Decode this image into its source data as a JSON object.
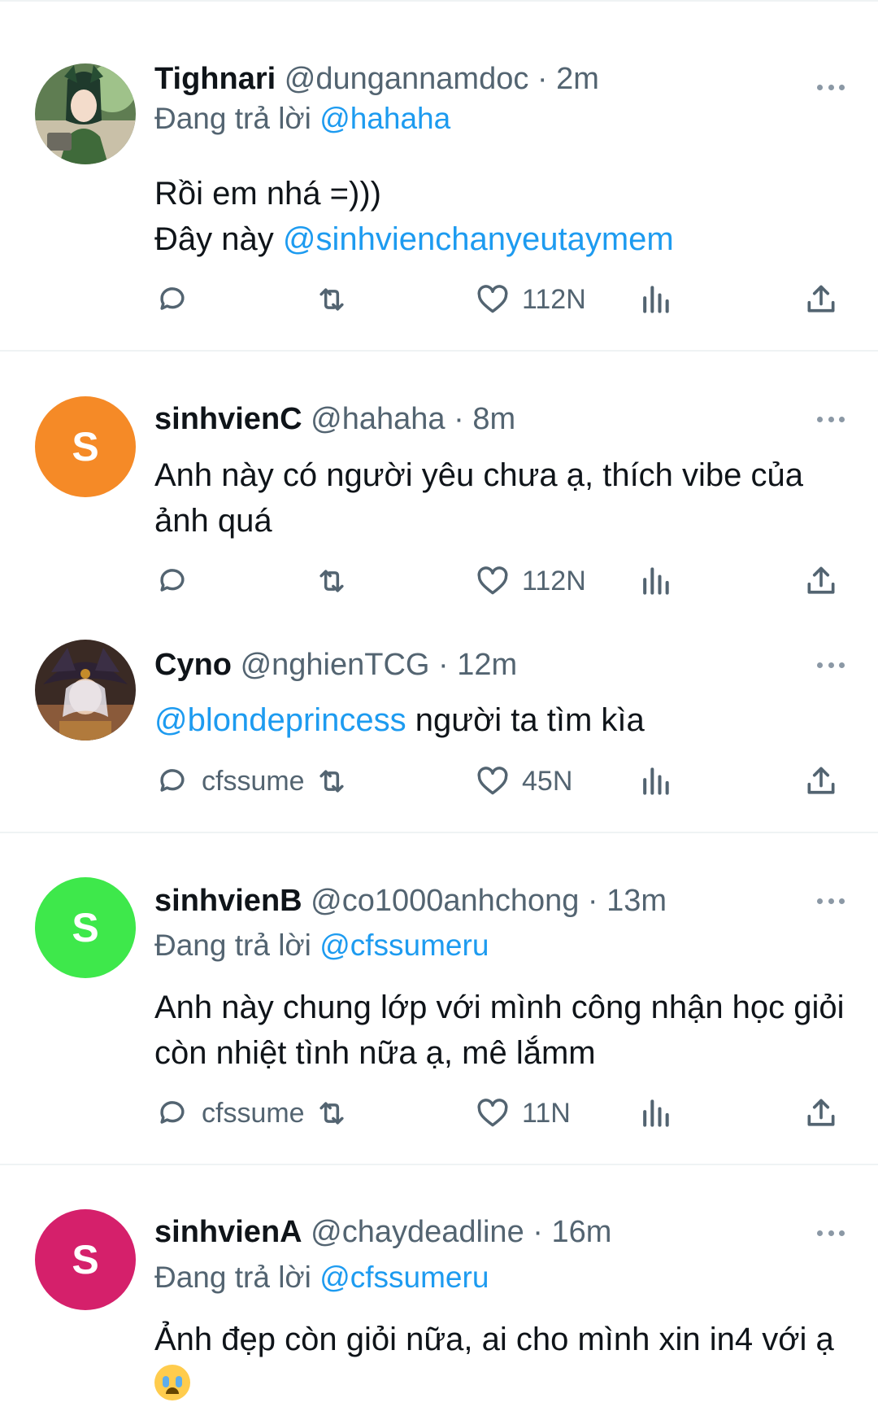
{
  "colors": {
    "link": "#1d9bf0",
    "secondary": "#536471",
    "text": "#0f1419"
  },
  "tweets": [
    {
      "avatar": {
        "type": "image",
        "alt": "tighnari-avatar"
      },
      "name": "Tighnari",
      "handle": "@dungannamdoc",
      "time": "2m",
      "reply_prefix": "Đang trả lời",
      "reply_to": "@hahaha",
      "line1": "Rồi em nhá =)))",
      "line2_text": "Đây này",
      "line2_mention": "@sinhvienchanyeutaymem",
      "reply_count": "",
      "like_count": "112N"
    },
    {
      "avatar": {
        "type": "letter",
        "letter": "S",
        "color": "#f58a27"
      },
      "name": "sinhvienC",
      "handle": "@hahaha",
      "time": "8m",
      "text": "Anh này có người yêu chưa ạ, thích vibe của ảnh quá",
      "reply_count": "",
      "like_count": "112N"
    },
    {
      "avatar": {
        "type": "image",
        "alt": "cyno-avatar"
      },
      "name": "Cyno",
      "handle": "@nghienTCG",
      "time": "12m",
      "mention": "@blondeprincess",
      "text": "người ta tìm kìa",
      "reply_count": "cfssume",
      "like_count": "45N"
    },
    {
      "avatar": {
        "type": "letter",
        "letter": "S",
        "color": "#3ee84b"
      },
      "name": "sinhvienB",
      "handle": "@co1000anhchong",
      "time": "13m",
      "reply_prefix": "Đang trả lời",
      "reply_to": "@cfssumeru",
      "text": "Anh này chung lớp với mình công nhận học giỏi còn nhiệt tình nữa ạ, mê lắmm",
      "reply_count": "cfssume",
      "like_count": "11N"
    },
    {
      "avatar": {
        "type": "letter",
        "letter": "S",
        "color": "#d5206b"
      },
      "name": "sinhvienA",
      "handle": "@chaydeadline",
      "time": "16m",
      "reply_prefix": "Đang trả lời",
      "reply_to": "@cfssumeru",
      "text": "Ảnh đẹp còn giỏi nữa, ai cho mình xin in4 với ạ",
      "emoji": "loudly-crying-face"
    }
  ],
  "separator_dot": "·"
}
